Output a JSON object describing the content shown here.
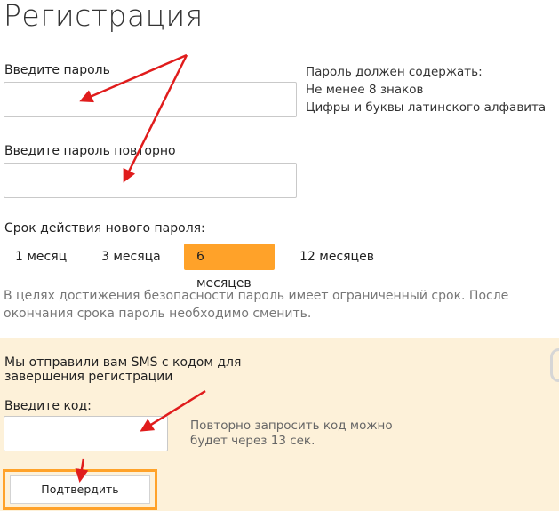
{
  "page": {
    "title": "Регистрация"
  },
  "password": {
    "label": "Введите пароль",
    "repeat_label": "Введите пароль повторно",
    "value": "",
    "repeat_value": ""
  },
  "requirements": {
    "heading": "Пароль должен содержать:",
    "rules": [
      "Не менее 8 знаков",
      "Цифры и буквы латинского алфавита"
    ]
  },
  "validity": {
    "label": "Срок действия нового пароля:",
    "options": [
      "1 месяц",
      "3 месяца",
      "6 месяцев",
      "12 месяцев"
    ],
    "selected": "6 месяцев",
    "note": "В целях достижения безопасности пароль имеет ограниченный срок. После окончания срока пароль необходимо сменить."
  },
  "sms": {
    "message_line1": "Мы отправили вам SMS с кодом для",
    "message_line2": "завершения регистрации",
    "code_label": "Введите код:",
    "code_value": "",
    "resend_line1": "Повторно запросить код можно",
    "resend_line2": "будет через 13 сек.",
    "confirm_label": "Подтвердить"
  },
  "colors": {
    "accent": "#ffa229",
    "panel_bg": "#fdf1d9",
    "annotation_arrow": "#e01c1c"
  },
  "annotations": {
    "arrow_icon": "red-arrow-icon"
  }
}
